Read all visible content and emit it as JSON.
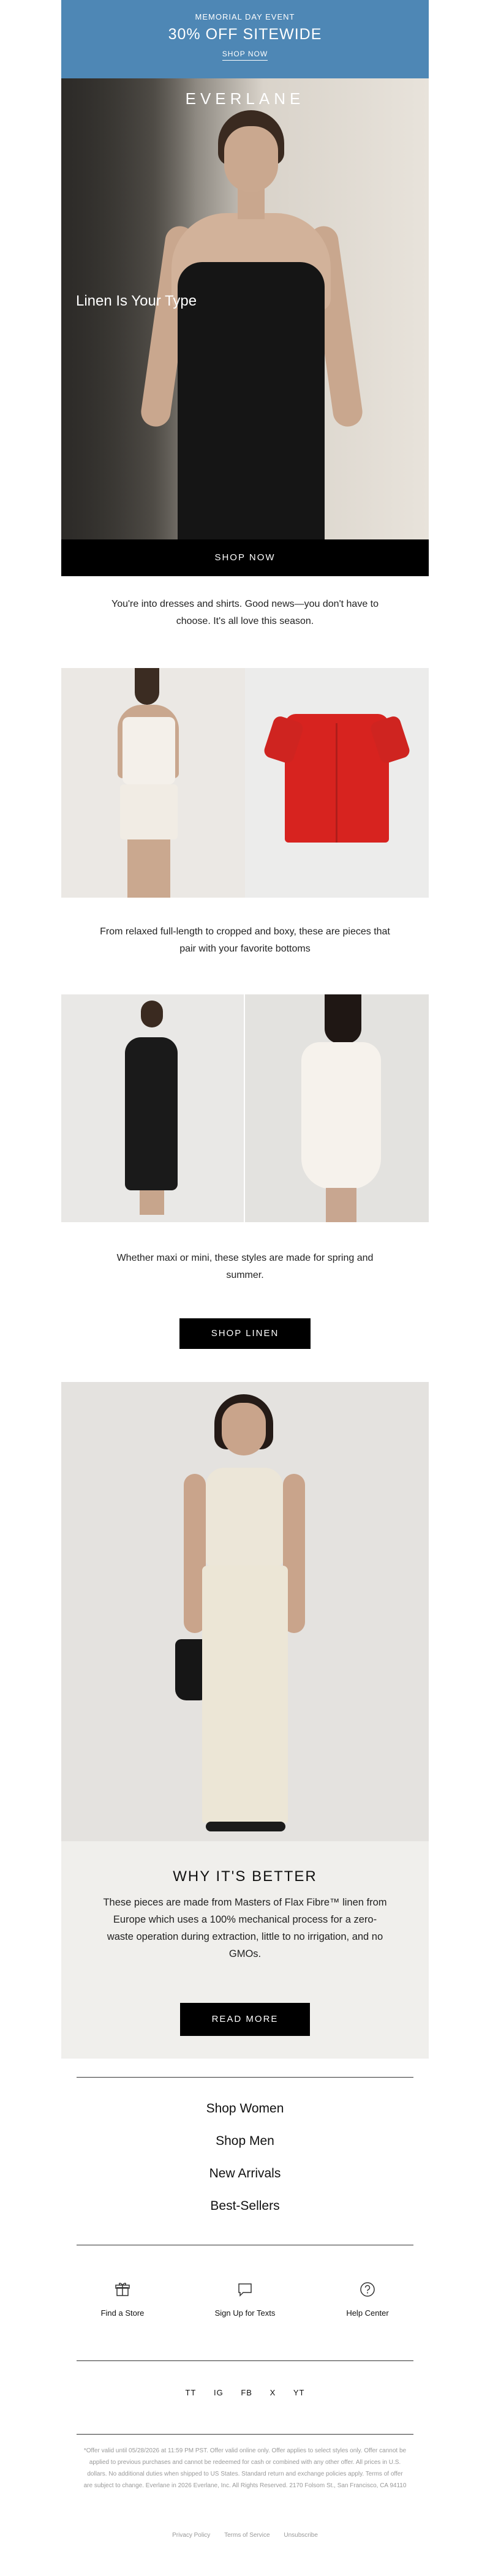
{
  "banner": {
    "eyebrow": "MEMORIAL DAY EVENT",
    "headline": "30% OFF SITEWIDE",
    "link": "SHOP NOW"
  },
  "hero": {
    "logo": "EVERLANE",
    "tagline": "Linen Is Your Type",
    "button": "SHOP NOW"
  },
  "intro_text": "You're into dresses and shirts. Good news—you don't have to choose. It's all love this  season.",
  "text_block_2": "From relaxed full-length to cropped and boxy, these are pieces that pair with your favorite bottoms",
  "text_block_3": "Whether maxi or mini, these styles are made for spring and summer.",
  "linen_button": "SHOP LINEN",
  "why": {
    "title": "WHY IT'S BETTER",
    "body": "These pieces are made from Masters of Flax Fibre™ linen from Europe which uses a 100% mechanical process for a zero-waste operation during extraction, little to no irrigation, and no GMOs.",
    "button": "READ MORE"
  },
  "nav": [
    "Shop Women",
    "Shop Men",
    "New Arrivals",
    "Best-Sellers"
  ],
  "services": [
    {
      "label": "Find a Store",
      "icon": "gift-icon"
    },
    {
      "label": "Sign Up for Texts",
      "icon": "chat-icon"
    },
    {
      "label": "Help Center",
      "icon": "question-icon"
    }
  ],
  "social": [
    "TT",
    "IG",
    "FB",
    "X",
    "YT"
  ],
  "fine_print": "*Offer valid until 05/28/2026 at 11:59 PM PST. Offer valid online only. Offer applies to select styles only. Offer cannot be applied to previous purchases and cannot be redeemed for cash or combined with any other offer. All prices in U.S. dollars. No additional duties when shipped to US States. Standard return and exchange policies apply. Terms of offer are subject to change. Everlane in 2026 Everlane, Inc. All Rights Reserved. 2170 Folsom St., San Francisco, CA 94110",
  "footer_links": [
    "Privacy Policy",
    "Terms of Service",
    "Unsubscribe"
  ],
  "colors": {
    "banner": "#4e87b5",
    "button": "#000000",
    "why_panel": "#f0efec"
  }
}
